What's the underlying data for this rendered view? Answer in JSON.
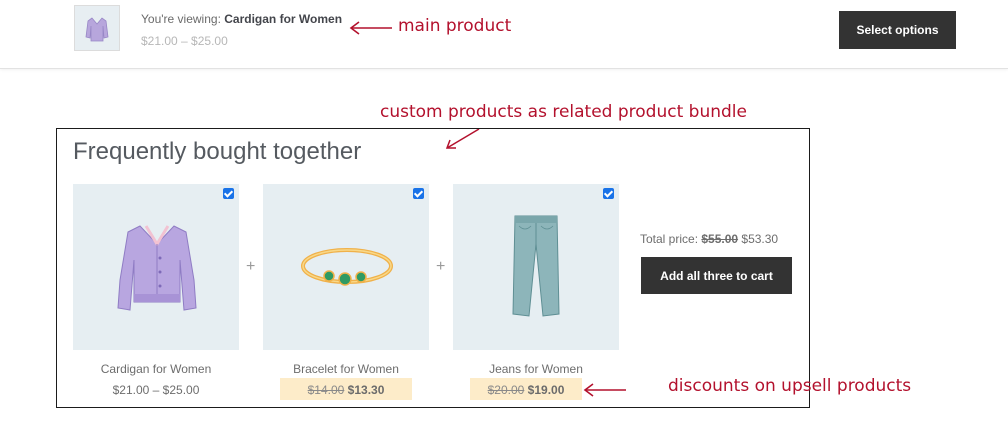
{
  "sticky_bar": {
    "viewing_prefix": "You're viewing: ",
    "product_name": "Cardigan for Women",
    "price_range": "$21.00 – $25.00",
    "button_label": "Select options"
  },
  "annotations": {
    "main_product": "main product",
    "custom_bundle": "custom products as related product bundle",
    "discounts": "discounts on upsell products"
  },
  "bundle": {
    "title": "Frequently bought together",
    "products": [
      {
        "name": "Cardigan for Women",
        "price": "$21.00 – $25.00",
        "checked": true
      },
      {
        "name": "Bracelet for Women",
        "old_price": "$14.00",
        "new_price": "$13.30",
        "checked": true
      },
      {
        "name": "Jeans for Women",
        "old_price": "$20.00",
        "new_price": "$19.00",
        "checked": true
      }
    ],
    "plus_sign": "+",
    "total_label": "Total price: ",
    "total_old": "$55.00",
    "total_new": "$53.30",
    "add_button_label": "Add all three to cart"
  },
  "colors": {
    "annotation": "#b3112d",
    "button_bg": "#333333",
    "image_bg": "#e6eef2",
    "discount_highlight": "#fdecc9",
    "checkbox": "#1a73e8"
  }
}
